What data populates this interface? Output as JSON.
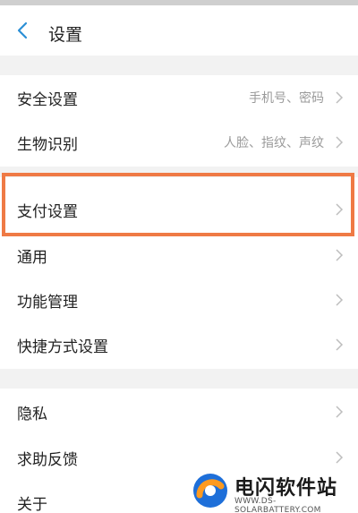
{
  "header": {
    "title": "设置",
    "back_icon": "back-arrow-icon"
  },
  "group1": [
    {
      "label": "安全设置",
      "value": "手机号、密码"
    },
    {
      "label": "生物识别",
      "value": "人脸、指纹、声纹"
    }
  ],
  "group2": [
    {
      "label": "支付设置",
      "value": ""
    },
    {
      "label": "通用",
      "value": ""
    },
    {
      "label": "功能管理",
      "value": ""
    },
    {
      "label": "快捷方式设置",
      "value": ""
    }
  ],
  "group3": [
    {
      "label": "隐私",
      "value": ""
    },
    {
      "label": "求助反馈",
      "value": ""
    },
    {
      "label": "关于",
      "value": ""
    }
  ],
  "watermark": {
    "name": "电闪软件站",
    "url": "WWW.DS-SOLARBATTERY.COM"
  },
  "colors": {
    "highlight": "#ef7a45",
    "back_icon": "#2b8fd6",
    "section_gap": "#f2f2f2"
  }
}
